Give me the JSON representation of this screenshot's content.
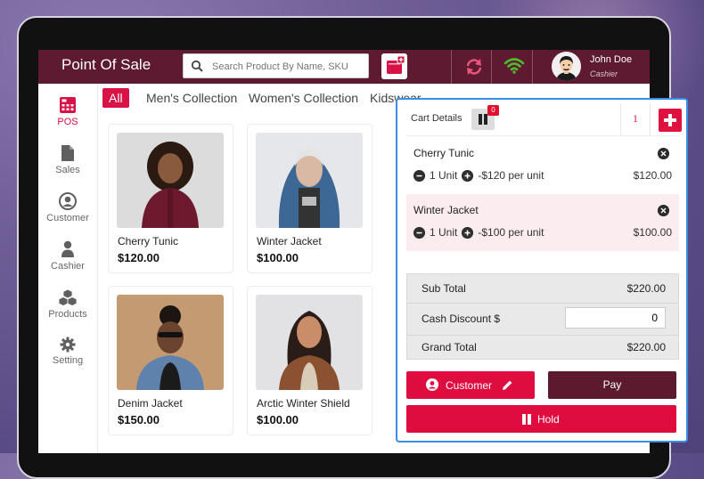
{
  "app": {
    "title": "Point Of Sale"
  },
  "search": {
    "placeholder": "Search Product By Name, SKU",
    "value": ""
  },
  "topbar": {
    "add_cart_icon": "cart-add-icon",
    "sync_icon": "sync-icon",
    "wifi_icon": "wifi-icon"
  },
  "user": {
    "name": "John Doe",
    "role": "Cashier"
  },
  "sidebar": {
    "items": [
      {
        "label": "POS",
        "icon": "calculator-icon",
        "active": true
      },
      {
        "label": "Sales",
        "icon": "document-icon",
        "active": false
      },
      {
        "label": "Customer",
        "icon": "user-circle-icon",
        "active": false
      },
      {
        "label": "Cashier",
        "icon": "user-icon",
        "active": false
      },
      {
        "label": "Products",
        "icon": "cubes-icon",
        "active": false
      },
      {
        "label": "Setting",
        "icon": "gear-icon",
        "active": false
      }
    ]
  },
  "categories": [
    "All",
    "Men's Collection",
    "Women's Collection",
    "Kidswear"
  ],
  "products": [
    {
      "name": "Cherry Tunic",
      "price": "$120.00"
    },
    {
      "name": "Winter Jacket",
      "price": "$100.00"
    },
    {
      "name": "Denim Jacket",
      "price": "$150.00"
    },
    {
      "name": "Arctic Winter Shield",
      "price": "$100.00"
    }
  ],
  "cart": {
    "title": "Cart Details",
    "held_count": "0",
    "item_count": "1",
    "lines": [
      {
        "name": "Cherry Tunic",
        "qty": "1 Unit",
        "unit_price": "-$120 per unit",
        "total": "$120.00"
      },
      {
        "name": "Winter Jacket",
        "qty": "1 Unit",
        "unit_price": "-$100 per unit",
        "total": "$100.00"
      }
    ],
    "subtotal_label": "Sub Total",
    "subtotal": "$220.00",
    "discount_label": "Cash Discount $",
    "discount_value": "0",
    "grand_total_label": "Grand Total",
    "grand_total": "$220.00",
    "customer_label": "Customer",
    "pay_label": "Pay",
    "hold_label": "Hold"
  },
  "colors": {
    "brand": "#5e1a31",
    "accent": "#df0d3f",
    "panel_border": "#3b8ee8"
  }
}
